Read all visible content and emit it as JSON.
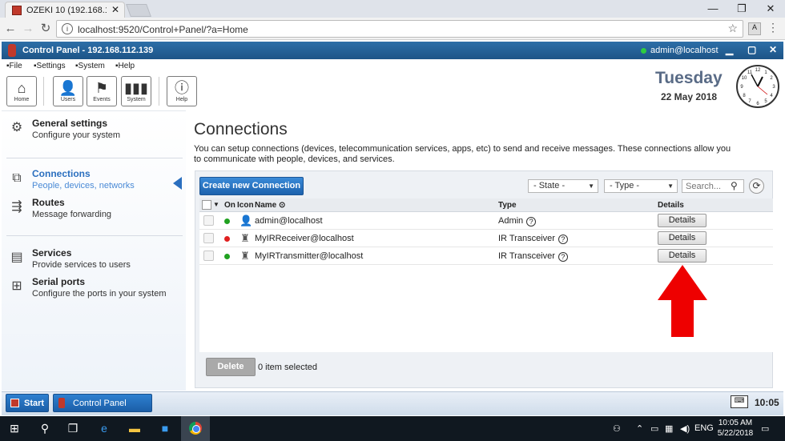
{
  "browser": {
    "tab_title": "OZEKI 10 (192.168.112.1:",
    "url": "localhost:9520/Control+Panel/?a=Home",
    "window_buttons": [
      "—",
      "❐",
      "✕"
    ]
  },
  "app": {
    "title": "Control Panel - 192.168.112.139",
    "user": "admin@localhost",
    "status_color": "#2ecc40",
    "menu": [
      "File",
      "Settings",
      "System",
      "Help"
    ],
    "toolbar": [
      {
        "label": "Home",
        "icon": "home-icon"
      },
      {
        "label": "Users",
        "icon": "user-icon"
      },
      {
        "label": "Events",
        "icon": "flag-icon"
      },
      {
        "label": "System",
        "icon": "bars-icon"
      },
      {
        "label": "Help",
        "icon": "info-icon"
      }
    ],
    "day": "Tuesday",
    "date": "22 May 2018"
  },
  "sidebar": {
    "items": [
      {
        "title": "General settings",
        "subtitle": "Configure your system",
        "icon": "gear-icon"
      },
      {
        "title": "Connections",
        "subtitle": "People, devices, networks",
        "icon": "connections-icon",
        "active": true
      },
      {
        "title": "Routes",
        "subtitle": "Message forwarding",
        "icon": "routes-icon"
      },
      {
        "title": "Services",
        "subtitle": "Provide services to users",
        "icon": "services-icon"
      },
      {
        "title": "Serial ports",
        "subtitle": "Configure the ports in your system",
        "icon": "serial-port-icon"
      }
    ]
  },
  "main": {
    "heading": "Connections",
    "description": "You can setup connections (devices, telecommunication services, apps, etc) to send and receive messages. These connections allow you to communicate with people, devices, and services.",
    "create_label": "Create new Connection",
    "state_filter": "- State -",
    "type_filter": "- Type -",
    "search_placeholder": "Search...",
    "columns": {
      "on": "On",
      "icon": "Icon",
      "name": "Name",
      "type": "Type",
      "details": "Details"
    },
    "rows": [
      {
        "status_color": "#21a121",
        "icon": "user-icon",
        "name": "admin@localhost",
        "type": "Admin",
        "details": "Details"
      },
      {
        "status_color": "#e02020",
        "icon": "ir-device-icon",
        "name": "MyIRReceiver@localhost",
        "type": "IR Transceiver",
        "details": "Details"
      },
      {
        "status_color": "#21a121",
        "icon": "ir-device-icon",
        "name": "MyIRTransmitter@localhost",
        "type": "IR Transceiver",
        "details": "Details"
      }
    ],
    "help_mark": "?",
    "delete_label": "Delete",
    "selected_text": "0 item selected",
    "annotation_arrow_color": "#ee0000"
  },
  "appbar": {
    "start_label": "Start",
    "task_label": "Control Panel",
    "time": "10:05"
  },
  "taskbar": {
    "time": "10:05 AM",
    "date": "5/22/2018",
    "lang": "ENG"
  }
}
